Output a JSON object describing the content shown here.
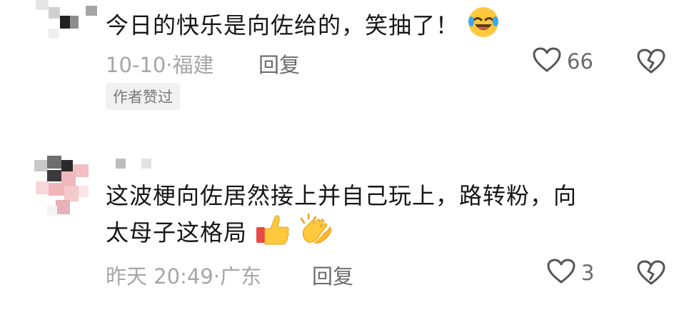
{
  "comments": [
    {
      "text": "今日的快乐是向佐给的，笑抽了！",
      "emoji": "rolling-laughing-emoji",
      "date": "10-10·",
      "location": "福建",
      "reply_label": "回复",
      "likes": "66",
      "badge": "作者赞过"
    },
    {
      "text_line1": "这波梗向佐居然接上并自己玩上，路转粉，向",
      "text_line2": "太母子这格局",
      "emojis": [
        "thumbs-up-emoji",
        "clapping-hands-emoji"
      ],
      "date": "昨天 20:49·",
      "location": "广东",
      "reply_label": "回复",
      "likes": "3"
    }
  ],
  "icons": {
    "like": "heart-outline-icon",
    "dislike": "broken-heart-icon"
  },
  "colors": {
    "text": "#161616",
    "meta": "#a6a6a6",
    "action": "#6b6b6b",
    "badge_bg": "#f1f1f1"
  }
}
